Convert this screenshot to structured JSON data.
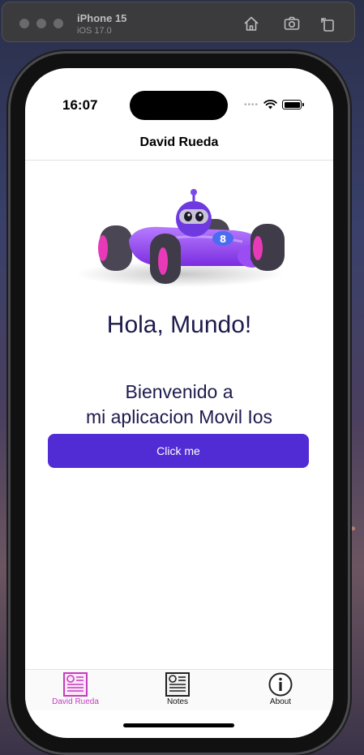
{
  "simulator": {
    "device_name": "iPhone 15",
    "os_version": "iOS 17.0",
    "toolbar_icons": [
      "home-icon",
      "screenshot-icon",
      "rotate-icon"
    ]
  },
  "status_bar": {
    "time": "16:07",
    "icons": [
      "cellular-signal-icon",
      "wifi-icon",
      "battery-icon"
    ]
  },
  "nav": {
    "title": "David Rueda"
  },
  "main": {
    "image": "robot-race-car-illustration",
    "greeting": "Hola, Mundo!",
    "welcome_line1": "Bienvenido a",
    "welcome_line2": "mi aplicacion Movil Ios",
    "button_label": "Click me"
  },
  "tabs": [
    {
      "label": "David Rueda",
      "icon": "newspaper-icon",
      "selected": true
    },
    {
      "label": "Notes",
      "icon": "newspaper-icon",
      "selected": false
    },
    {
      "label": "About",
      "icon": "info-icon",
      "selected": false
    }
  ],
  "colors": {
    "accent": "#512BD4",
    "selected_tab": "#C53BBF",
    "heading_text": "#1D1A4D",
    "background": "#FFFFFF"
  }
}
